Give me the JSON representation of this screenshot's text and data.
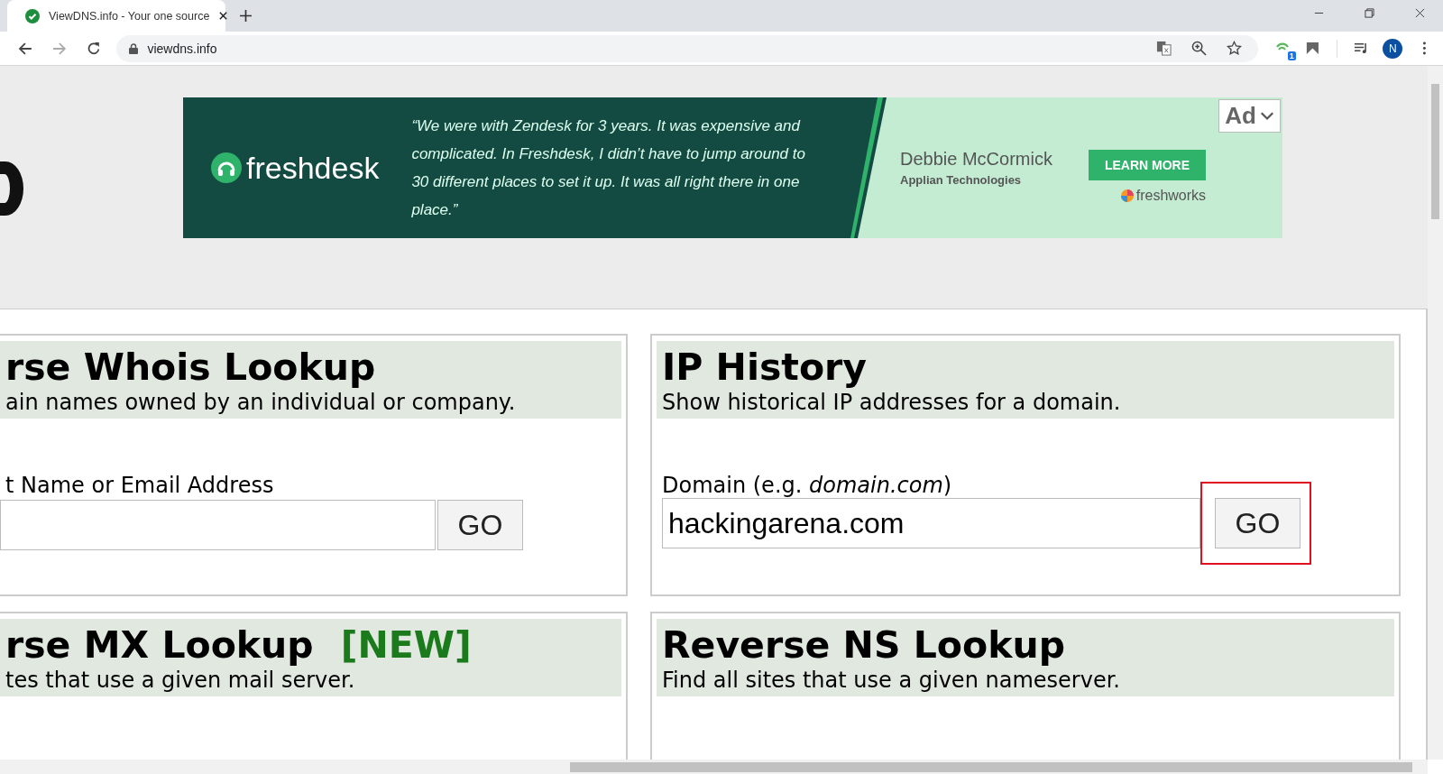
{
  "browser": {
    "tab": {
      "title": "ViewDNS.info - Your one source",
      "selected": true
    },
    "url": "viewdns.info",
    "profile": "N",
    "extension_badge": "1"
  },
  "ad": {
    "logo": "freshdesk",
    "quote": "“We were with Zendesk for 3 years. It was expensive and complicated. In Freshdesk, I didn’t have to jump around to 30 different places to set it up. It was all right there in one place.”",
    "person": "Debbie McCormick",
    "company": "Applian Technologies",
    "button": "LEARN MORE",
    "brand": "freshworks",
    "label": "Ad"
  },
  "panels": [
    {
      "title": "rse Whois Lookup",
      "subtitle": "ain names owned by an individual or company.",
      "field_label": "t Name or Email Address",
      "button": "GO",
      "highlighted": false
    },
    {
      "title": "IP History",
      "subtitle": "Show historical IP addresses for a domain.",
      "field_label": "Domain (e.g. *domain.com*)",
      "value": "hackingarena.com",
      "button": "GO",
      "highlighted": true
    },
    {
      "title": "rse MX Lookup",
      "badge": "[NEW]",
      "subtitle": "tes that use a given mail server."
    },
    {
      "title": "Reverse NS Lookup",
      "subtitle": "Find all sites that use a given nameserver."
    }
  ]
}
